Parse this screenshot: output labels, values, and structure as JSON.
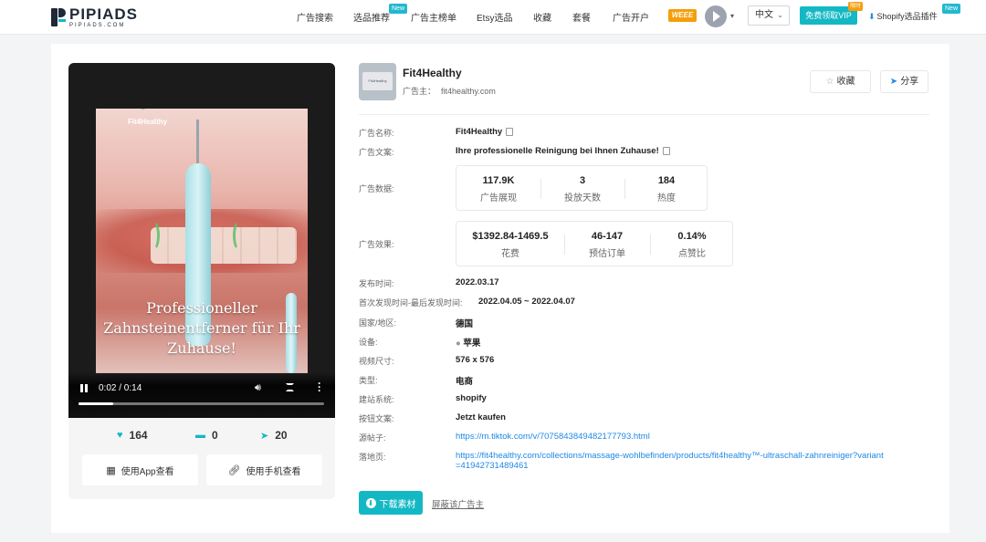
{
  "header": {
    "logo_name": "PIPIADS",
    "logo_sub": "PIPIADS.COM",
    "nav": [
      {
        "label": "广告搜索",
        "badge": ""
      },
      {
        "label": "选品推荐",
        "badge": "New"
      },
      {
        "label": "广告主榜单",
        "badge": ""
      },
      {
        "label": "Etsy选品",
        "badge": ""
      },
      {
        "label": "收藏",
        "badge": ""
      },
      {
        "label": "套餐",
        "badge": ""
      },
      {
        "label": "广告开户",
        "badge": ""
      }
    ],
    "weee_label": "WEEE",
    "language": "中文",
    "vip_button": "免费领取VIP",
    "vip_badge": "限时",
    "plugin_label": "Shopify选品插件",
    "plugin_badge": "New"
  },
  "video": {
    "brand": "Fit4Healthy",
    "overlay_text": "Professioneller Zahnsteinentferner für Ihr Zuhause!",
    "time": "0:02 / 0:14",
    "progress": 0.14
  },
  "stats": {
    "likes": "164",
    "comments": "0",
    "shares": "20"
  },
  "actions": {
    "app_view": "使用App查看",
    "phone_view": "使用手机查看"
  },
  "advertiser": {
    "name": "Fit4Healthy",
    "label": "广告主：",
    "domain": "fit4healthy.com",
    "fav": "收藏",
    "share": "分享"
  },
  "details": {
    "ad_name_label": "广告名称:",
    "ad_name": "Fit4Healthy",
    "ad_copy_label": "广告文案:",
    "ad_copy": "Ihre professionelle Reinigung bei Ihnen Zuhause!",
    "data_label": "广告数据:",
    "data_metrics": [
      {
        "value": "117.9K",
        "label": "广告展现"
      },
      {
        "value": "3",
        "label": "投放天数"
      },
      {
        "value": "184",
        "label": "热度"
      }
    ],
    "effect_label": "广告效果:",
    "effect_metrics": [
      {
        "value": "$1392.84-1469.5",
        "label": "花费"
      },
      {
        "value": "46-147",
        "label": "预估订单"
      },
      {
        "value": "0.14%",
        "label": "点赞比"
      }
    ],
    "publish_label": "发布时间:",
    "publish": "2022.03.17",
    "seen_label": "首次发现时间-最后发现时间:",
    "seen": "2022.04.05 ~ 2022.04.07",
    "country_label": "国家/地区:",
    "country": "德国",
    "device_label": "设备:",
    "device": "苹果",
    "size_label": "视频尺寸:",
    "size": "576 x 576",
    "type_label": "类型:",
    "type": "电商",
    "system_label": "建站系统:",
    "system": "shopify",
    "cta_label": "按钮文案:",
    "cta": "Jetzt kaufen",
    "source_label": "源帖子:",
    "source": "https://m.tiktok.com/v/7075843849482177793.html",
    "landing_label": "落地页:",
    "landing_1": "https://fit4healthy.com/collections/massage-wohlbefinden/products/fit4healthy™-ultraschall-zahnreiniger?variant",
    "landing_2": "=41942731489461"
  },
  "footer": {
    "download": "下载素材",
    "block": "屏蔽该广告主"
  },
  "colors": {
    "accent": "#14b8c4",
    "link": "#1e88e5"
  }
}
